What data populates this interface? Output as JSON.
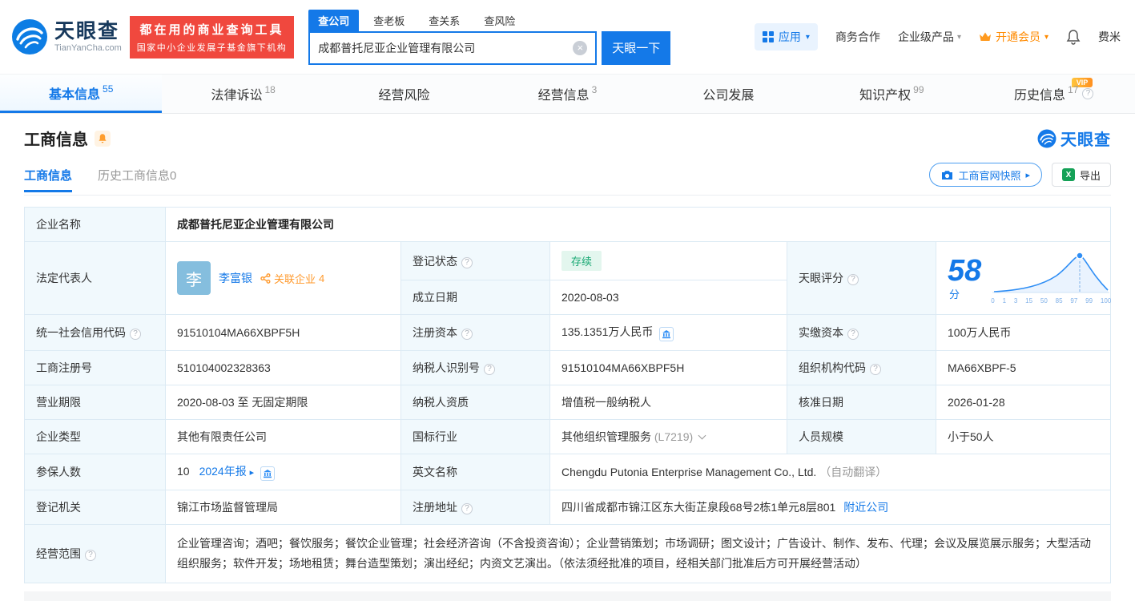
{
  "icons": {
    "help": "?",
    "caret_down": "▾",
    "arrow_right": "▸",
    "close": "×",
    "excel": "X"
  },
  "header": {
    "logo": {
      "brand": "天眼查",
      "domain": "TianYanCha.com"
    },
    "slogan": {
      "line1": "都在用的商业查询工具",
      "line2": "国家中小企业发展子基金旗下机构"
    },
    "search": {
      "tabs": [
        {
          "label": "查公司"
        },
        {
          "label": "查老板"
        },
        {
          "label": "查关系"
        },
        {
          "label": "查风险"
        }
      ],
      "value": "成都普托尼亚企业管理有限公司",
      "button": "天眼一下"
    },
    "menu": {
      "apps": "应用",
      "cooperation": "商务合作",
      "enterprise": "企业级产品",
      "vip": "开通会员",
      "user": "费米"
    }
  },
  "nav": {
    "tabs": [
      {
        "label": "基本信息",
        "count": "55"
      },
      {
        "label": "法律诉讼",
        "count": "18"
      },
      {
        "label": "经营风险",
        "count": ""
      },
      {
        "label": "经营信息",
        "count": "3"
      },
      {
        "label": "公司发展",
        "count": ""
      },
      {
        "label": "知识产权",
        "count": "99"
      },
      {
        "label": "历史信息",
        "count": "17",
        "badge": "VIP"
      }
    ]
  },
  "section": {
    "title": "工商信息",
    "watermark": "天眼查",
    "subtabs": [
      {
        "label": "工商信息"
      },
      {
        "label": "历史工商信息0"
      }
    ],
    "snapshot_button": "工商官网快照",
    "export_button": "导出"
  },
  "info": {
    "company_name": {
      "label": "企业名称",
      "value": "成都普托尼亚企业管理有限公司"
    },
    "legal_rep": {
      "label": "法定代表人",
      "avatar": "李",
      "name": "李富银",
      "related_label": "关联企业",
      "related_count": "4"
    },
    "reg_status": {
      "label": "登记状态",
      "value": "存续"
    },
    "establish_date": {
      "label": "成立日期",
      "value": "2020-08-03"
    },
    "score": {
      "label": "天眼评分",
      "value": "58",
      "unit": "分",
      "ticks": [
        "0",
        "1",
        "3",
        "15",
        "50",
        "85",
        "97",
        "99",
        "100"
      ]
    },
    "credit_code": {
      "label": "统一社会信用代码",
      "value": "91510104MA66XBPF5H"
    },
    "reg_capital": {
      "label": "注册资本",
      "value": "135.1351万人民币"
    },
    "paid_capital": {
      "label": "实缴资本",
      "value": "100万人民币"
    },
    "reg_number": {
      "label": "工商注册号",
      "value": "510104002328363"
    },
    "taxpayer_id": {
      "label": "纳税人识别号",
      "value": "91510104MA66XBPF5H"
    },
    "org_code": {
      "label": "组织机构代码",
      "value": "MA66XBPF-5"
    },
    "business_term": {
      "label": "营业期限",
      "value": "2020-08-03 至 无固定期限"
    },
    "taxpayer_quality": {
      "label": "纳税人资质",
      "value": "增值税一般纳税人"
    },
    "approval_date": {
      "label": "核准日期",
      "value": "2026-01-28"
    },
    "company_type": {
      "label": "企业类型",
      "value": "其他有限责任公司"
    },
    "industry": {
      "label": "国标行业",
      "value": "其他组织管理服务",
      "code": "(L7219)"
    },
    "staff_size": {
      "label": "人员规模",
      "value": "小于50人"
    },
    "insured": {
      "label": "参保人数",
      "value": "10",
      "report": "2024年报"
    },
    "english_name": {
      "label": "英文名称",
      "value": "Chengdu Putonia Enterprise Management Co., Ltd.",
      "note": "（自动翻译）"
    },
    "reg_authority": {
      "label": "登记机关",
      "value": "锦江市场监督管理局"
    },
    "address": {
      "label": "注册地址",
      "value": "四川省成都市锦江区东大街芷泉段68号2栋1单元8层801",
      "nearby": "附近公司"
    },
    "scope": {
      "label": "经营范围",
      "value": "企业管理咨询；酒吧；餐饮服务；餐饮企业管理；社会经济咨询（不含投资咨询）；企业营销策划；市场调研；图文设计；广告设计、制作、发布、代理；会议及展览展示服务；大型活动组织服务；软件开发；场地租赁；舞台造型策划；演出经纪；内资文艺演出。（依法须经批准的项目，经相关部门批准后方可开展经营活动）"
    }
  }
}
